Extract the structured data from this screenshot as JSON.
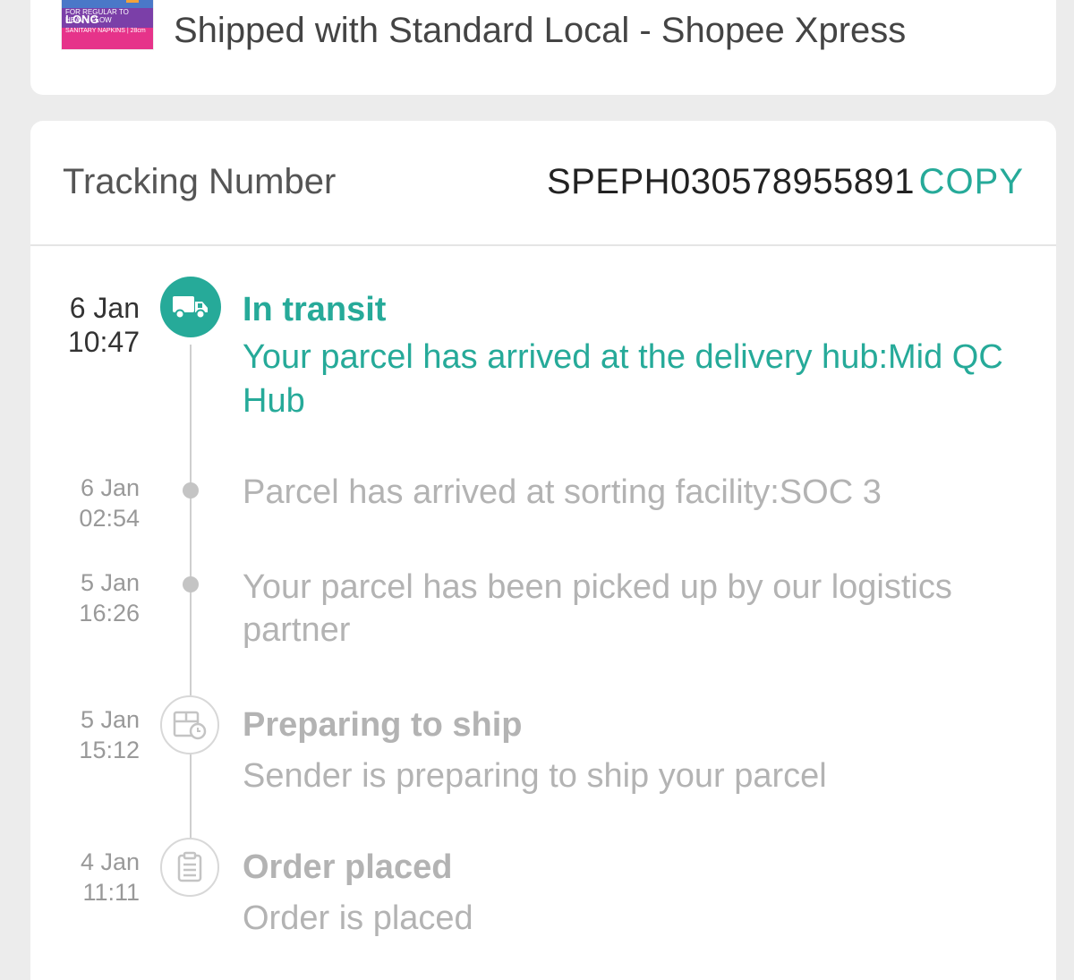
{
  "shipping": {
    "product_image": {
      "top_text": "FOR REGULAR TO HEAVY FLOW",
      "name": "LONG",
      "bottom_text": "SANITARY NAPKINS | 28cm"
    },
    "text": "Shipped with Standard Local - Shopee Xpress"
  },
  "tracking": {
    "label": "Tracking Number",
    "number": "SPEPH030578955891",
    "copy_label": "COPY"
  },
  "timeline": [
    {
      "date": "6 Jan",
      "time": "10:47",
      "title": "In transit",
      "description": "Your parcel has arrived at the delivery hub:Mid QC Hub",
      "icon": "truck-icon",
      "status": "active"
    },
    {
      "date": "6 Jan",
      "time": "02:54",
      "title": "",
      "description": "Parcel has arrived at sorting facility:SOC 3",
      "icon": "dot",
      "status": "past"
    },
    {
      "date": "5 Jan",
      "time": "16:26",
      "title": "",
      "description": "Your parcel has been picked up by our logistics partner",
      "icon": "dot",
      "status": "past"
    },
    {
      "date": "5 Jan",
      "time": "15:12",
      "title": "Preparing to ship",
      "description": "Sender is preparing to ship your parcel",
      "icon": "package-clock-icon",
      "status": "past"
    },
    {
      "date": "4 Jan",
      "time": "11:11",
      "title": "Order placed",
      "description": "Order is placed",
      "icon": "clipboard-icon",
      "status": "past"
    }
  ],
  "colors": {
    "accent": "#26aa99",
    "muted_text": "#b3b3b3",
    "background": "#ececec"
  }
}
